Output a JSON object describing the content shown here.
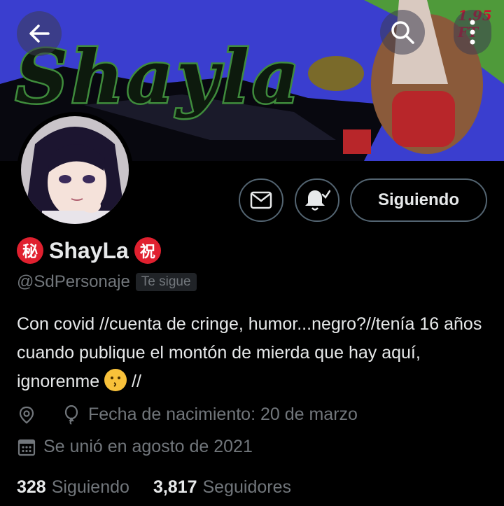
{
  "banner": {
    "title": "Shayla",
    "price_tag": "1.95 FT"
  },
  "icons": {
    "back": "arrow-left-icon",
    "search": "search-icon",
    "more": "more-icon",
    "message": "envelope-icon",
    "notifications": "bell-icon",
    "location": "location-pin-icon",
    "birthday": "balloon-icon",
    "calendar": "calendar-icon"
  },
  "actions": {
    "follow_label": "Siguiendo"
  },
  "profile": {
    "badge_left": "秘",
    "name": "ShayLa",
    "badge_right": "祝",
    "handle": "@SdPersonaje",
    "follows_you": "Te sigue",
    "bio": "Con covid //cuenta de cringe, humor...negro?//tenía 16 años cuando publique el montón de mierda que hay aquí, ignorenme",
    "bio_suffix": " //",
    "birthday": "Fecha de nacimiento: 20 de marzo",
    "joined": "Se unió en agosto de 2021"
  },
  "stats": {
    "following_count": "328",
    "following_label": "Siguiendo",
    "followers_count": "3,817",
    "followers_label": "Seguidores"
  },
  "colors": {
    "background": "#000000",
    "text": "#e7e9ea",
    "muted": "#71767b",
    "banner_blue": "#3a3ecf",
    "banner_green": "#4f9a3a"
  }
}
